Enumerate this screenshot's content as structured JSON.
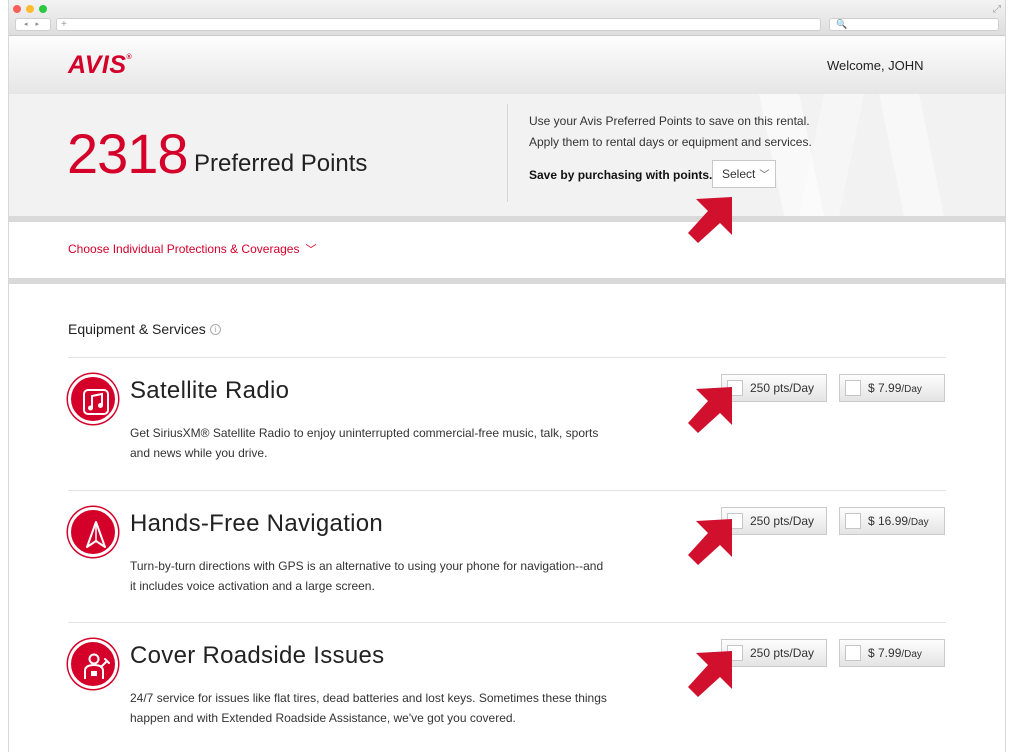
{
  "browser": {
    "url_placeholder": "+",
    "search_placeholder": "🔍",
    "nav_glyphs": "◂ ▸",
    "expand_glyph": "⤢"
  },
  "header": {
    "logo_text": "AVIS",
    "logo_mark": "®",
    "welcome": "Welcome, JOHN"
  },
  "points": {
    "value": "2318",
    "label": "Preferred Points",
    "promo_line1": "Use your Avis Preferred Points to save on this rental.",
    "promo_line2": "Apply them to rental days or equipment and services.",
    "save_label": "Save by purchasing with points.",
    "select_label": "Select",
    "select_chevron": "﹀"
  },
  "coverage": {
    "link_label": "Choose Individual Protections & Coverages",
    "chevron": "﹀"
  },
  "equipment": {
    "section_title": "Equipment & Services",
    "info_glyph": "i",
    "items": [
      {
        "icon": "music-note-icon",
        "title": "Satellite Radio",
        "desc_line1": "Get SiriusXM® Satellite Radio to enjoy uninterrupted commercial-free music, talk, sports",
        "desc_line2": "and news while you drive.",
        "points_price": "250 pts/Day",
        "usd_amount": "$ 7.99",
        "usd_unit": "/Day"
      },
      {
        "icon": "navigation-arrow-icon",
        "title": "Hands-Free Navigation",
        "desc_line1": "Turn-by-turn directions with GPS is an alternative to using your phone for navigation--and",
        "desc_line2": "it includes voice activation and a large screen.",
        "points_price": "250 pts/Day",
        "usd_amount": "$ 16.99",
        "usd_unit": "/Day"
      },
      {
        "icon": "roadside-assistance-icon",
        "title": "Cover Roadside Issues",
        "desc_line1": "24/7 service for issues like flat tires, dead batteries and lost keys. Sometimes these things",
        "desc_line2": "happen and with Extended Roadside Assistance, we've got you covered.",
        "points_price": "250 pts/Day",
        "usd_amount": "$ 7.99",
        "usd_unit": "/Day"
      }
    ]
  },
  "colors": {
    "brand_red": "#d4002a",
    "annotation_arrow": "#d0102d"
  }
}
